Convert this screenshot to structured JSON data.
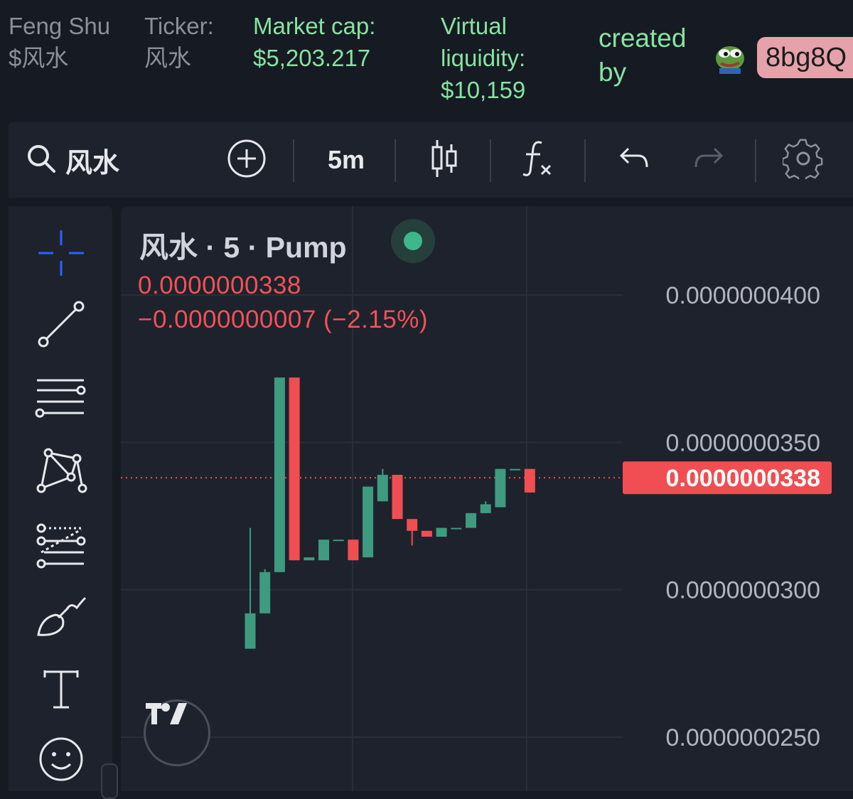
{
  "header": {
    "name_label": "Feng Shu $风水",
    "ticker_label": "Ticker:",
    "ticker_value": "风水",
    "market_cap_label": "Market cap:",
    "market_cap_value": "$5,203.217",
    "liquidity_label": "Virtual liquidity:",
    "liquidity_value": "$10,159",
    "created_by_label": "created by",
    "creator_address": "8bg8Q",
    "avatar_icon": "pepe-frog-avatar-icon"
  },
  "toolbar": {
    "symbol": "风水",
    "interval": "5m",
    "icons": [
      "search-icon",
      "add-symbol-icon",
      "candlestick-icon",
      "indicators-icon",
      "undo-icon",
      "redo-icon",
      "settings-icon"
    ]
  },
  "tools": [
    "crosshair-icon",
    "trend-line-icon",
    "horizontal-lines-icon",
    "pattern-icon",
    "fib-icon",
    "brush-icon",
    "text-icon",
    "emoji-icon"
  ],
  "legend": {
    "title": "风水 · 5 · Pump",
    "price": "0.0000000338",
    "change": "−0.0000000007 (−2.15%)"
  },
  "chart_data": {
    "type": "candlestick",
    "interval": "5m",
    "y_ticks": [
      "0.0000000400",
      "0.0000000350",
      "0.0000000300",
      "0.0000000250"
    ],
    "y_tick_values": [
      4e-08,
      3.5e-08,
      3e-08,
      2.5e-08
    ],
    "last_price_label": "0.0000000338",
    "last_price": 3.38e-08,
    "up_color": "#3e9b80",
    "down_color": "#f04e52",
    "candles": [
      {
        "o": 2.8e-08,
        "h": 3.21e-08,
        "l": 2.8e-08,
        "c": 2.92e-08
      },
      {
        "o": 2.92e-08,
        "h": 3.07e-08,
        "l": 2.92e-08,
        "c": 3.06e-08
      },
      {
        "o": 3.06e-08,
        "h": 3.72e-08,
        "l": 3.06e-08,
        "c": 3.72e-08
      },
      {
        "o": 3.72e-08,
        "h": 3.72e-08,
        "l": 3.1e-08,
        "c": 3.1e-08
      },
      {
        "o": 3.1e-08,
        "h": 3.11e-08,
        "l": 3.1e-08,
        "c": 3.11e-08
      },
      {
        "o": 3.1e-08,
        "h": 3.17e-08,
        "l": 3.1e-08,
        "c": 3.17e-08
      },
      {
        "o": 3.17e-08,
        "h": 3.17e-08,
        "l": 3.17e-08,
        "c": 3.17e-08
      },
      {
        "o": 3.17e-08,
        "h": 3.17e-08,
        "l": 3.1e-08,
        "c": 3.1e-08
      },
      {
        "o": 3.11e-08,
        "h": 3.35e-08,
        "l": 3.11e-08,
        "c": 3.35e-08
      },
      {
        "o": 3.3e-08,
        "h": 3.41e-08,
        "l": 3.3e-08,
        "c": 3.39e-08
      },
      {
        "o": 3.39e-08,
        "h": 3.39e-08,
        "l": 3.24e-08,
        "c": 3.24e-08
      },
      {
        "o": 3.24e-08,
        "h": 3.24e-08,
        "l": 3.15e-08,
        "c": 3.2e-08
      },
      {
        "o": 3.2e-08,
        "h": 3.2e-08,
        "l": 3.18e-08,
        "c": 3.18e-08
      },
      {
        "o": 3.18e-08,
        "h": 3.21e-08,
        "l": 3.18e-08,
        "c": 3.21e-08
      },
      {
        "o": 3.21e-08,
        "h": 3.21e-08,
        "l": 3.21e-08,
        "c": 3.21e-08
      },
      {
        "o": 3.21e-08,
        "h": 3.26e-08,
        "l": 3.21e-08,
        "c": 3.26e-08
      },
      {
        "o": 3.26e-08,
        "h": 3.3e-08,
        "l": 3.26e-08,
        "c": 3.29e-08
      },
      {
        "o": 3.28e-08,
        "h": 3.41e-08,
        "l": 3.28e-08,
        "c": 3.41e-08
      },
      {
        "o": 3.41e-08,
        "h": 3.41e-08,
        "l": 3.41e-08,
        "c": 3.41e-08
      },
      {
        "o": 3.41e-08,
        "h": 3.41e-08,
        "l": 3.33e-08,
        "c": 3.33e-08
      }
    ]
  }
}
